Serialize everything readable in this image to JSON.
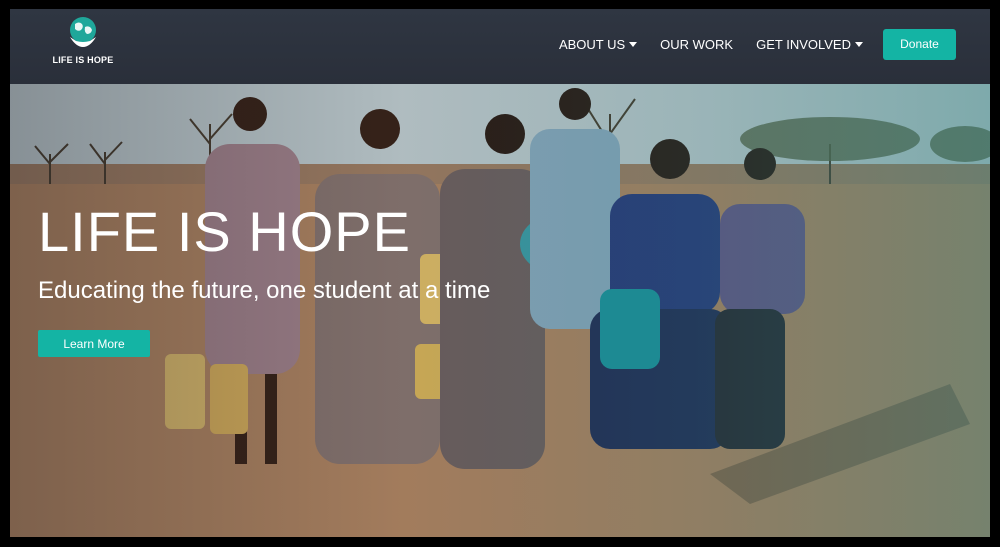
{
  "header": {
    "brand_name": "LIFE IS HOPE",
    "nav_items": [
      {
        "label": "ABOUT US",
        "has_dropdown": true
      },
      {
        "label": "OUR WORK",
        "has_dropdown": false
      },
      {
        "label": "GET INVOLVED",
        "has_dropdown": true
      }
    ],
    "donate_label": "Donate"
  },
  "hero": {
    "title": "LIFE IS HOPE",
    "subtitle": "Educating the future, one student at a time",
    "cta_label": "Learn More"
  },
  "colors": {
    "accent": "#14b4a4",
    "header_bg": "#2f3642"
  }
}
